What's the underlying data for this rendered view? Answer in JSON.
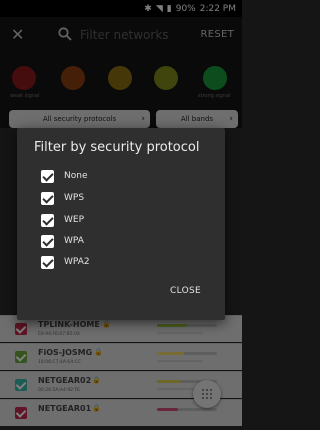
{
  "status_bar": {
    "battery": "90%",
    "time": "2:22 PM"
  },
  "header": {
    "search_placeholder": "Filter networks",
    "reset_label": "RESET"
  },
  "signal_filter": {
    "weak_label": "weak signal",
    "strong_label": "strong signal",
    "colors": [
      "#8b1a1a",
      "#8a3f10",
      "#8a6f10",
      "#7f8a18",
      "#1a9a3a"
    ]
  },
  "filters": {
    "security_label": "All security protocols",
    "bands_label": "All bands"
  },
  "networks": [
    {
      "name": "TPLINK-HOME",
      "mac": "E8:94:F6:07:B5:04",
      "checkbox_color": "#c0284a",
      "signal_color": "#9bc43b",
      "signal": 0.5
    },
    {
      "name": "FiOS-JOSMG",
      "mac": "18:06:C7:4A:64:CC",
      "checkbox_color": "#6aa83a",
      "signal_color": "#f0d86a",
      "signal": 0.45
    },
    {
      "name": "NETGEAR02",
      "mac": "00:26:5A:A4:92:FE",
      "checkbox_color": "#3bb8a6",
      "signal_color": "#d8d050",
      "signal": 0.4
    },
    {
      "name": "NETGEAR01",
      "mac": "",
      "checkbox_color": "#c0284a",
      "signal_color": "#d04a7a",
      "signal": 0.35
    }
  ],
  "dialog": {
    "title": "Filter by security protocol",
    "options": [
      {
        "label": "None",
        "checked": true
      },
      {
        "label": "WPS",
        "checked": true
      },
      {
        "label": "WEP",
        "checked": true
      },
      {
        "label": "WPA",
        "checked": true
      },
      {
        "label": "WPA2",
        "checked": true
      }
    ],
    "close_label": "CLOSE"
  }
}
